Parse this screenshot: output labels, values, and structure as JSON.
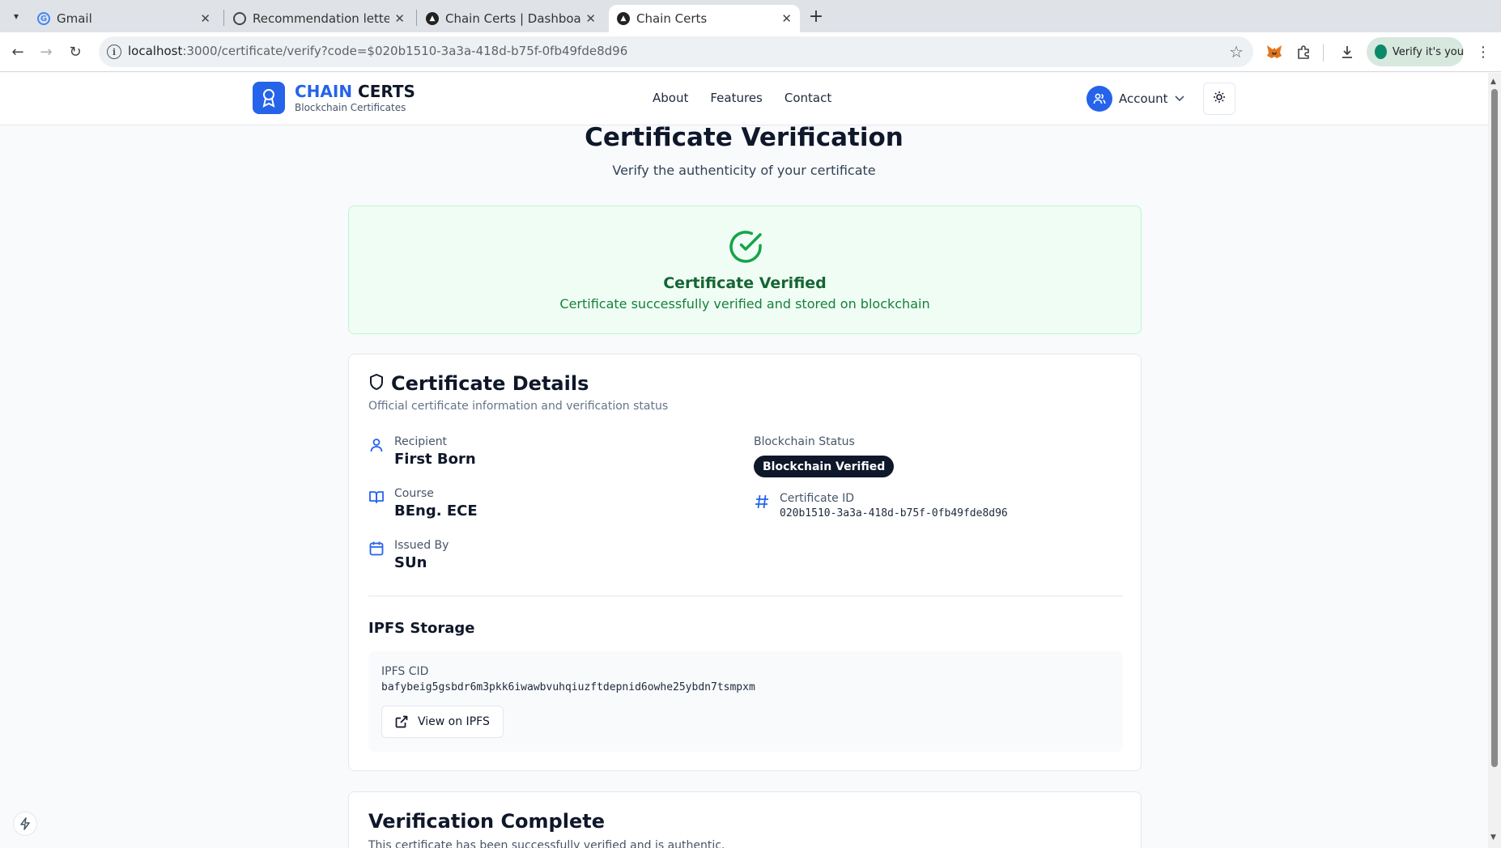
{
  "browser": {
    "tabs": [
      {
        "title": "Gmail",
        "icon": "google-icon"
      },
      {
        "title": "Recommendation letter",
        "icon": "openai-icon"
      },
      {
        "title": "Chain Certs | Dashboard",
        "icon": "vercel-icon"
      },
      {
        "title": "Chain Certs",
        "icon": "vercel-icon",
        "active": true
      }
    ],
    "url_host": "localhost",
    "url_rest": ":3000/certificate/verify?code=$020b1510-3a3a-418d-b75f-0fb49fde8d96",
    "profile_pill": "Verify it's you"
  },
  "header": {
    "brand_part1": "CHAIN",
    "brand_part2": "CERTS",
    "brand_sub": "Blockchain Certificates",
    "nav": [
      "About",
      "Features",
      "Contact"
    ],
    "account_label": "Account"
  },
  "main": {
    "title": "Certificate Verification",
    "subtitle": "Verify the authenticity of your certificate",
    "status": {
      "title": "Certificate Verified",
      "message": "Certificate successfully verified and stored on blockchain"
    },
    "details": {
      "title": "Certificate Details",
      "description": "Official certificate information and verification status",
      "recipient_label": "Recipient",
      "recipient": "First Born",
      "course_label": "Course",
      "course": "BEng. ECE",
      "issuer_label": "Issued By",
      "issuer": "SUn",
      "blockchain_status_label": "Blockchain Status",
      "blockchain_status": "Blockchain Verified",
      "certificate_id_label": "Certificate ID",
      "certificate_id": "020b1510-3a3a-418d-b75f-0fb49fde8d96"
    },
    "ipfs": {
      "title": "IPFS Storage",
      "cid_label": "IPFS CID",
      "cid": "bafybeig5gsbdr6m3pkk6iwawbvuhqiuzftdepnid6owhe25ybdn7tsmpxm",
      "button": "View on IPFS"
    },
    "complete": {
      "title": "Verification Complete",
      "message": "This certificate has been successfully verified and is authentic."
    }
  },
  "colors": {
    "accent": "#2563eb",
    "success": "#16a34a",
    "dark": "#0f172a"
  }
}
